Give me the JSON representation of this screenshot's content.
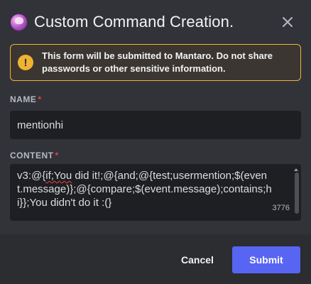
{
  "modal": {
    "title": "Custom Command Creation."
  },
  "notice": {
    "text_before": "This form will be submitted to ",
    "app_name": "Mantaro",
    "text_after": ". Do not share passwords or other sensitive information.",
    "accent_color": "#f0b232"
  },
  "fields": {
    "name": {
      "label": "NAME",
      "required_marker": "*",
      "value": "mentionhi"
    },
    "content": {
      "label": "CONTENT",
      "required_marker": "*",
      "value_prefix": "v3:@{",
      "value_misspelled": "if;You",
      "value_rest": " did it!;@{and;@{test;usermention;$(event.message)};@{compare;$(event.message);contains;hi}};You didn't do it :(}",
      "remaining_chars": "3776"
    }
  },
  "footer": {
    "cancel_label": "Cancel",
    "submit_label": "Submit",
    "submit_color": "#5865f2"
  },
  "icons": {
    "avatar": "bot-avatar",
    "close": "close-icon",
    "warning": "warning-icon"
  }
}
